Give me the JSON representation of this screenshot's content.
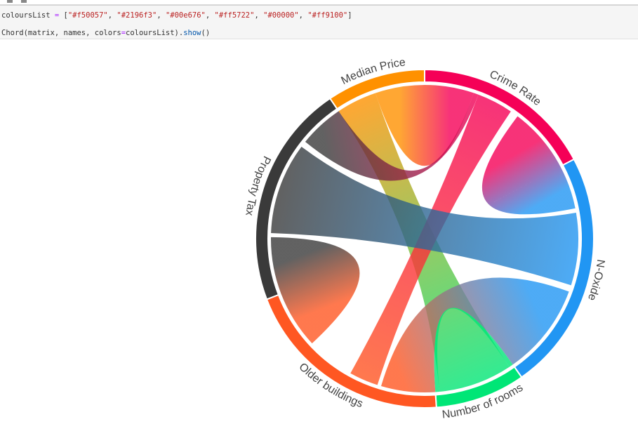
{
  "code": {
    "line1_var": "coloursList",
    "line1_op": " = ",
    "line1_open": "[",
    "colours": [
      "\"#f50057\"",
      "\"#2196f3\"",
      "\"#00e676\"",
      "\"#ff5722\"",
      "\"#00000\"",
      "\"#ff9100\""
    ],
    "line1_close": "]",
    "line2_call": "Chord",
    "line2_args": "(matrix, names, colors",
    "line2_eq": "=",
    "line2_rest": "coloursList).",
    "line2_method": "show",
    "line2_end": "()"
  },
  "chart_data": {
    "type": "chord",
    "groups": [
      {
        "name": "Crime Rate",
        "color": "#f50057",
        "share": 62
      },
      {
        "name": "N-Oxide",
        "color": "#2196f3",
        "share": 83
      },
      {
        "name": "Number of rooms",
        "color": "#00e676",
        "share": 31
      },
      {
        "name": "Older buildings",
        "color": "#ff5722",
        "share": 73
      },
      {
        "name": "Property Tax",
        "color": "#3a3a3a",
        "share": 77
      },
      {
        "name": "Median Price",
        "color": "#ff9100",
        "share": 34
      }
    ],
    "links": [
      {
        "source": "Median Price",
        "target": "Crime Rate"
      },
      {
        "source": "Median Price",
        "target": "Number of rooms"
      },
      {
        "source": "Crime Rate",
        "target": "Older buildings"
      },
      {
        "source": "Crime Rate",
        "target": "N-Oxide"
      },
      {
        "source": "Property Tax",
        "target": "Crime Rate"
      },
      {
        "source": "Property Tax",
        "target": "N-Oxide"
      },
      {
        "source": "Property Tax",
        "target": "Older buildings"
      },
      {
        "source": "N-Oxide",
        "target": "Older buildings"
      },
      {
        "source": "Number of rooms",
        "target": "Number of rooms"
      }
    ]
  }
}
